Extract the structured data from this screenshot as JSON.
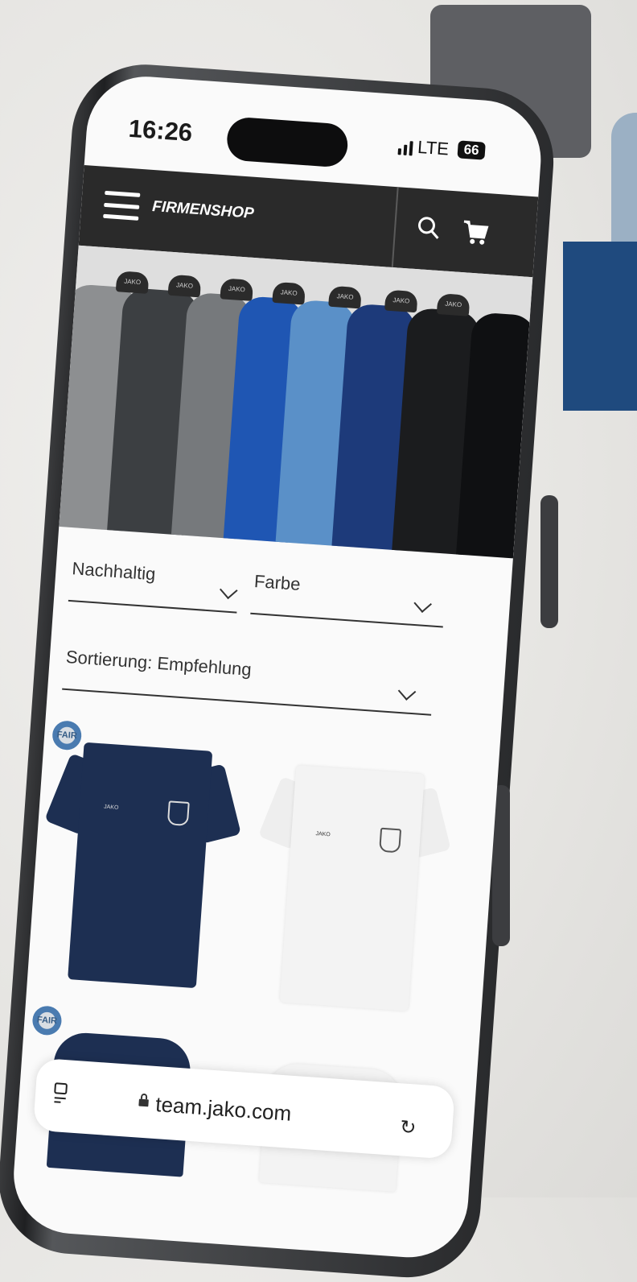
{
  "status_bar": {
    "time": "16:26",
    "network": "LTE",
    "battery": "66"
  },
  "header": {
    "brand": "FIRMENSHOP",
    "menu_icon": "hamburger-menu-icon",
    "search_icon": "search-icon",
    "cart_icon": "cart-icon"
  },
  "hero": {
    "hanger_label": "JAKO"
  },
  "filters": {
    "sustainable": "Nachhaltig",
    "color": "Farbe",
    "sort": "Sortierung: Empfehlung"
  },
  "products": [
    {
      "badge": "FAIR",
      "color": "navy"
    },
    {
      "badge": "",
      "color": "white"
    },
    {
      "badge": "FAIR",
      "color": "navy"
    },
    {
      "badge": "",
      "color": "white"
    }
  ],
  "browser": {
    "url": "team.jako.com"
  },
  "colors": {
    "nav_bg": "#2a2a2a",
    "navy_shirt": "#1d2f52",
    "accent_blue": "#1f4a7e"
  }
}
